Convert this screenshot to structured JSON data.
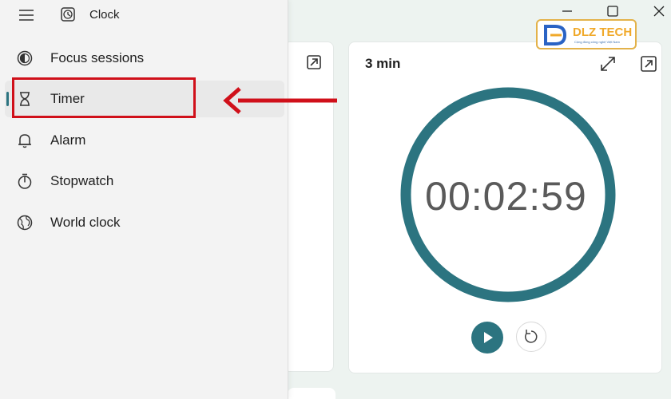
{
  "app": {
    "title": "Clock",
    "icon": "clock-app-icon"
  },
  "nav": {
    "items": [
      {
        "label": "Focus sessions",
        "icon": "focus-sessions-icon",
        "selected": false
      },
      {
        "label": "Timer",
        "icon": "hourglass-icon",
        "selected": true
      },
      {
        "label": "Alarm",
        "icon": "bell-icon",
        "selected": false
      },
      {
        "label": "Stopwatch",
        "icon": "stopwatch-icon",
        "selected": false
      },
      {
        "label": "World clock",
        "icon": "globe-icon",
        "selected": false
      }
    ]
  },
  "timer": {
    "title": "3 min",
    "time": "00:02:59",
    "buttons": {
      "play": "play-icon",
      "reset": "reset-icon",
      "expand": "expand-icon",
      "pin": "pin-icon"
    }
  },
  "window_controls": [
    "minimize-icon",
    "maximize-icon",
    "close-icon"
  ],
  "watermark": {
    "text": "DLZ TECH",
    "tagline": "Cộng đồng công nghệ Việt Nam"
  },
  "colors": {
    "accent": "#2c7480",
    "annotation": "#d0101a",
    "nav_background": "#f3f3f3",
    "app_background": "#edf3f0",
    "logo_orange": "#f0a92a",
    "logo_blue": "#2a63c4"
  }
}
